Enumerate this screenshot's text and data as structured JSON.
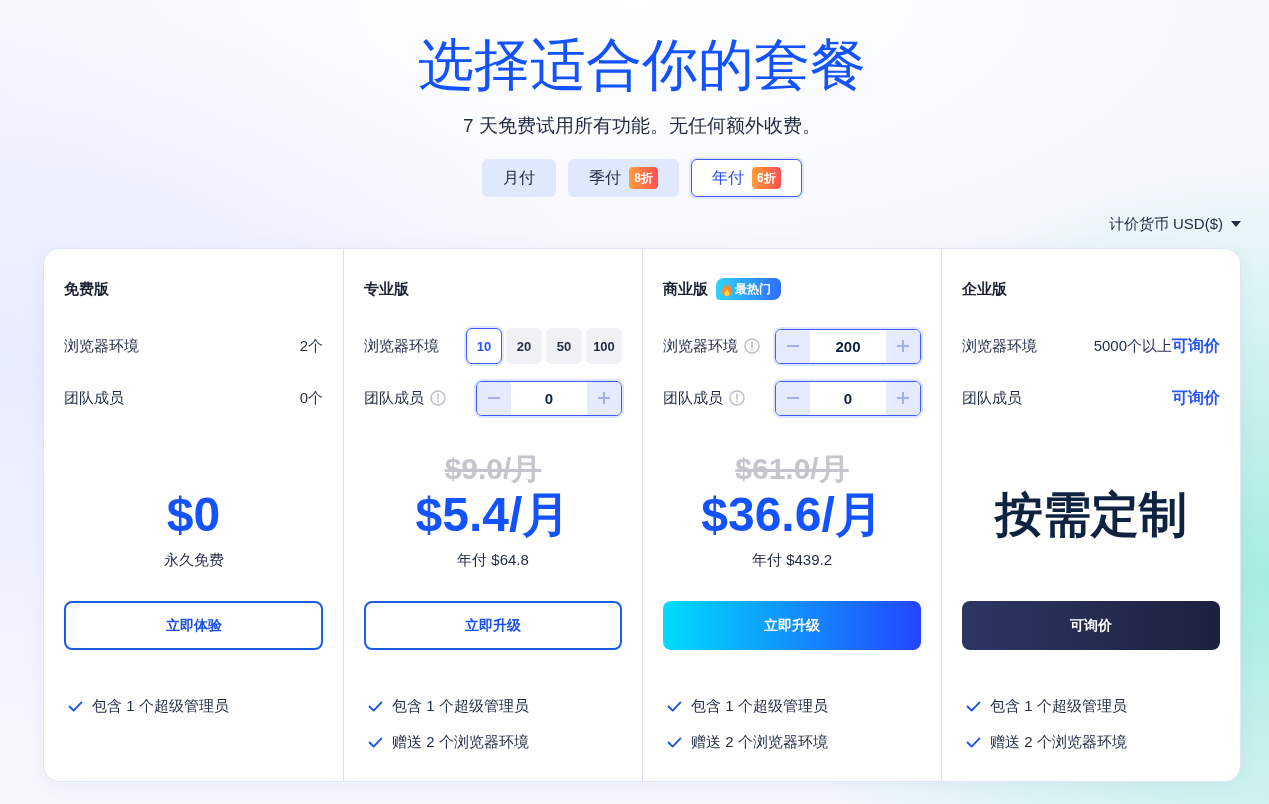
{
  "title": "选择适合你的套餐",
  "subtitle": "7 天免费试用所有功能。无任何额外收费。",
  "billing_tabs": [
    {
      "label": "月付",
      "selected": false
    },
    {
      "label": "季付",
      "badge": "8折",
      "selected": false
    },
    {
      "label": "年付",
      "badge": "6折",
      "selected": true
    }
  ],
  "currency": {
    "label": "计价货币 USD($)"
  },
  "plans": [
    {
      "name": "免费版",
      "rows": [
        {
          "kind": "value",
          "label": "浏览器环境",
          "info": false,
          "value": "2个"
        },
        {
          "kind": "value",
          "label": "团队成员",
          "info": false,
          "value": "0个"
        }
      ],
      "price": {
        "kind": "amount",
        "text": "$0"
      },
      "note": "永久免费",
      "button": {
        "kind": "outline",
        "label": "立即体验"
      },
      "features": [
        "包含 1 个超级管理员"
      ]
    },
    {
      "name": "专业版",
      "rows": [
        {
          "kind": "options",
          "label": "浏览器环境",
          "info": false,
          "options": [
            {
              "label": "10",
              "selected": true
            },
            {
              "label": "20",
              "selected": false
            },
            {
              "label": "50",
              "selected": false
            },
            {
              "label": "100",
              "selected": false
            }
          ]
        },
        {
          "kind": "stepper",
          "label": "团队成员",
          "info": true,
          "value": "0"
        }
      ],
      "old_price": "$9.0/月",
      "price": {
        "kind": "amount",
        "text": "$5.4/月"
      },
      "note": "年付 $64.8",
      "button": {
        "kind": "outline",
        "label": "立即升级"
      },
      "features": [
        "包含 1 个超级管理员",
        "赠送 2 个浏览器环境"
      ]
    },
    {
      "name": "商业版",
      "badge": "最热门",
      "rows": [
        {
          "kind": "stepper",
          "label": "浏览器环境",
          "info": true,
          "value": "200"
        },
        {
          "kind": "stepper",
          "label": "团队成员",
          "info": true,
          "value": "0"
        }
      ],
      "old_price": "$61.0/月",
      "price": {
        "kind": "amount",
        "text": "$36.6/月"
      },
      "note": "年付 $439.2",
      "button": {
        "kind": "gradient",
        "label": "立即升级"
      },
      "features": [
        "包含 1 个超级管理员",
        "赠送 2 个浏览器环境"
      ]
    },
    {
      "name": "企业版",
      "rows": [
        {
          "kind": "value",
          "label": "浏览器环境",
          "info": false,
          "value": "5000个以上",
          "link": "可询价"
        },
        {
          "kind": "value",
          "label": "团队成员",
          "info": false,
          "link": "可询价"
        }
      ],
      "price": {
        "kind": "custom",
        "text": "按需定制"
      },
      "button": {
        "kind": "dark",
        "label": "可询价"
      },
      "features": [
        "包含 1 个超级管理员",
        "赠送 2 个浏览器环境"
      ]
    }
  ]
}
